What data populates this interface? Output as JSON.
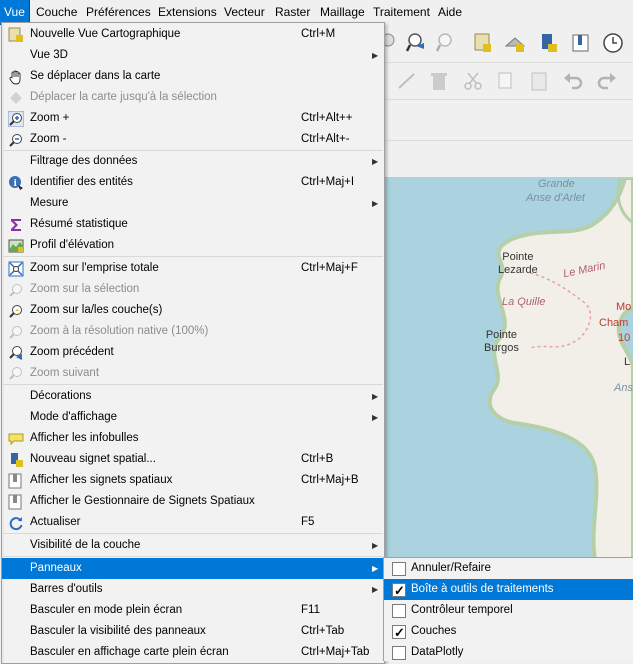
{
  "menubar": {
    "items": [
      {
        "label": "Vue",
        "active": true
      },
      {
        "label": "Couche"
      },
      {
        "label": "Préférences"
      },
      {
        "label": "Extensions"
      },
      {
        "label": "Vecteur"
      },
      {
        "label": "Raster"
      },
      {
        "label": "Maillage"
      },
      {
        "label": "Traitement"
      },
      {
        "label": "Aide"
      }
    ]
  },
  "menu": {
    "items": [
      {
        "label": "Nouvelle Vue Cartographique",
        "shortcut": "Ctrl+M",
        "icon": "new-map-view-icon"
      },
      {
        "label": "Vue 3D",
        "submenu": true
      },
      {
        "label": "Se déplacer dans la carte",
        "icon": "pan-hand-icon"
      },
      {
        "label": "Déplacer la carte jusqu'à la sélection",
        "disabled": true,
        "icon": "pan-to-selection-icon"
      },
      {
        "label": "Zoom +",
        "shortcut": "Ctrl+Alt++",
        "icon": "zoom-in-icon"
      },
      {
        "label": "Zoom -",
        "shortcut": "Ctrl+Alt+-",
        "icon": "zoom-out-icon"
      },
      {
        "label": "Filtrage des données",
        "submenu": true
      },
      {
        "label": "Identifier des entités",
        "shortcut": "Ctrl+Maj+I",
        "icon": "identify-icon"
      },
      {
        "label": "Mesure",
        "submenu": true
      },
      {
        "label": "Résumé statistique",
        "icon": "sum-icon"
      },
      {
        "label": "Profil d'élévation",
        "icon": "elevation-profile-icon"
      },
      {
        "label": "Zoom sur l'emprise totale",
        "shortcut": "Ctrl+Maj+F",
        "icon": "zoom-full-icon"
      },
      {
        "label": "Zoom sur la sélection",
        "disabled": true,
        "icon": "zoom-selection-icon"
      },
      {
        "label": "Zoom sur la/les couche(s)",
        "icon": "zoom-layer-icon"
      },
      {
        "label": "Zoom à la résolution native (100%)",
        "disabled": true,
        "icon": "zoom-native-icon"
      },
      {
        "label": "Zoom précédent",
        "icon": "zoom-last-icon"
      },
      {
        "label": "Zoom suivant",
        "disabled": true,
        "icon": "zoom-next-icon"
      },
      {
        "label": "Décorations",
        "submenu": true
      },
      {
        "label": "Mode d'affichage",
        "submenu": true
      },
      {
        "label": "Afficher les infobulles",
        "icon": "map-tips-icon"
      },
      {
        "label": "Nouveau signet spatial...",
        "shortcut": "Ctrl+B",
        "icon": "new-bookmark-icon"
      },
      {
        "label": "Afficher les signets spatiaux",
        "shortcut": "Ctrl+Maj+B",
        "icon": "show-bookmarks-icon"
      },
      {
        "label": "Afficher le Gestionnaire de Signets Spatiaux",
        "icon": "bookmark-manager-icon"
      },
      {
        "label": "Actualiser",
        "shortcut": "F5",
        "icon": "refresh-icon"
      },
      {
        "label": "Visibilité de la couche",
        "submenu": true
      },
      {
        "label": "Panneaux",
        "submenu": true,
        "highlighted": true
      },
      {
        "label": "Barres d'outils",
        "submenu": true
      },
      {
        "label": "Basculer en mode plein écran",
        "shortcut": "F11"
      },
      {
        "label": "Basculer la visibilité des panneaux",
        "shortcut": "Ctrl+Tab"
      },
      {
        "label": "Basculer en affichage carte plein écran",
        "shortcut": "Ctrl+Maj+Tab"
      }
    ]
  },
  "submenu": {
    "items": [
      {
        "label": "Annuler/Refaire",
        "checked": false
      },
      {
        "label": "Boîte à outils de traitements",
        "checked": true,
        "highlighted": true
      },
      {
        "label": "Contrôleur temporel",
        "checked": false
      },
      {
        "label": "Couches",
        "checked": true
      },
      {
        "label": "DataPlotly",
        "checked": false
      }
    ]
  },
  "map": {
    "labels": {
      "grande": "Grande",
      "anse_arlet": "Anse d'Arlet",
      "pointe_lezarde": "Pointe\nLezarde",
      "le_marin": "Le Marin",
      "la_quille": "La Quille",
      "pointe_burgos": "Pointe\nBurgos",
      "red1": "Mo",
      "red2": "Cham",
      "red3": "10",
      "anse": "Ans",
      "l_letter": "L"
    }
  },
  "colors": {
    "accent": "#0078d7",
    "menu_bg": "#f2f2f2",
    "water": "#aad3df",
    "land": "#f2efe9"
  }
}
